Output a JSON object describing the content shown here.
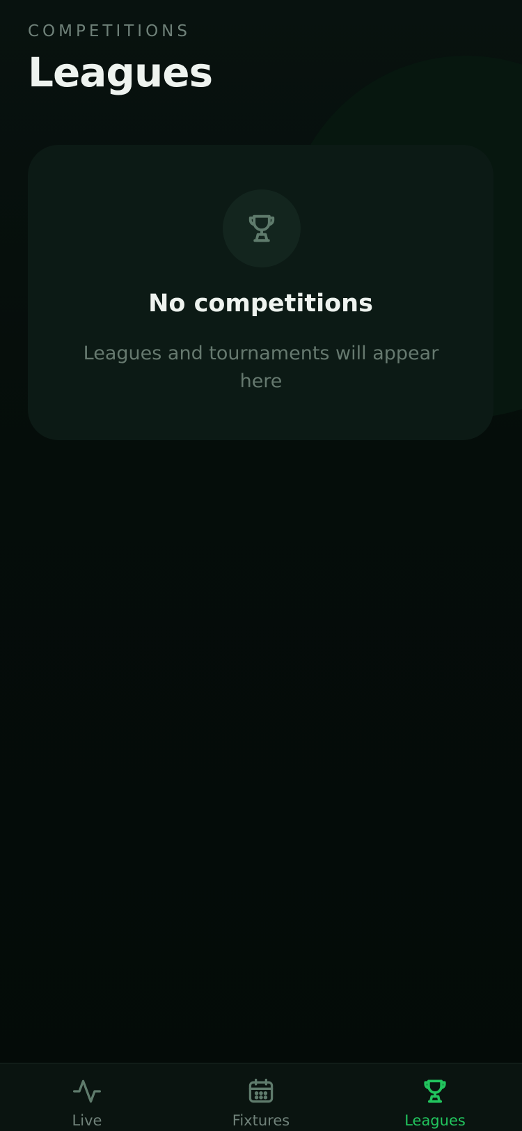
{
  "header": {
    "eyebrow": "COMPETITIONS",
    "title": "Leagues"
  },
  "empty_state": {
    "icon": "trophy-icon",
    "title": "No competitions",
    "subtitle": "Leagues and tournaments will appear here"
  },
  "tabs": [
    {
      "label": "Live",
      "icon": "activity-icon",
      "active": false
    },
    {
      "label": "Fixtures",
      "icon": "calendar-icon",
      "active": false
    },
    {
      "label": "Leagues",
      "icon": "trophy-icon",
      "active": true
    }
  ],
  "colors": {
    "accent": "#22c55e",
    "muted": "#6f8179",
    "background": "#050d0a",
    "card": "#0c1a15"
  }
}
